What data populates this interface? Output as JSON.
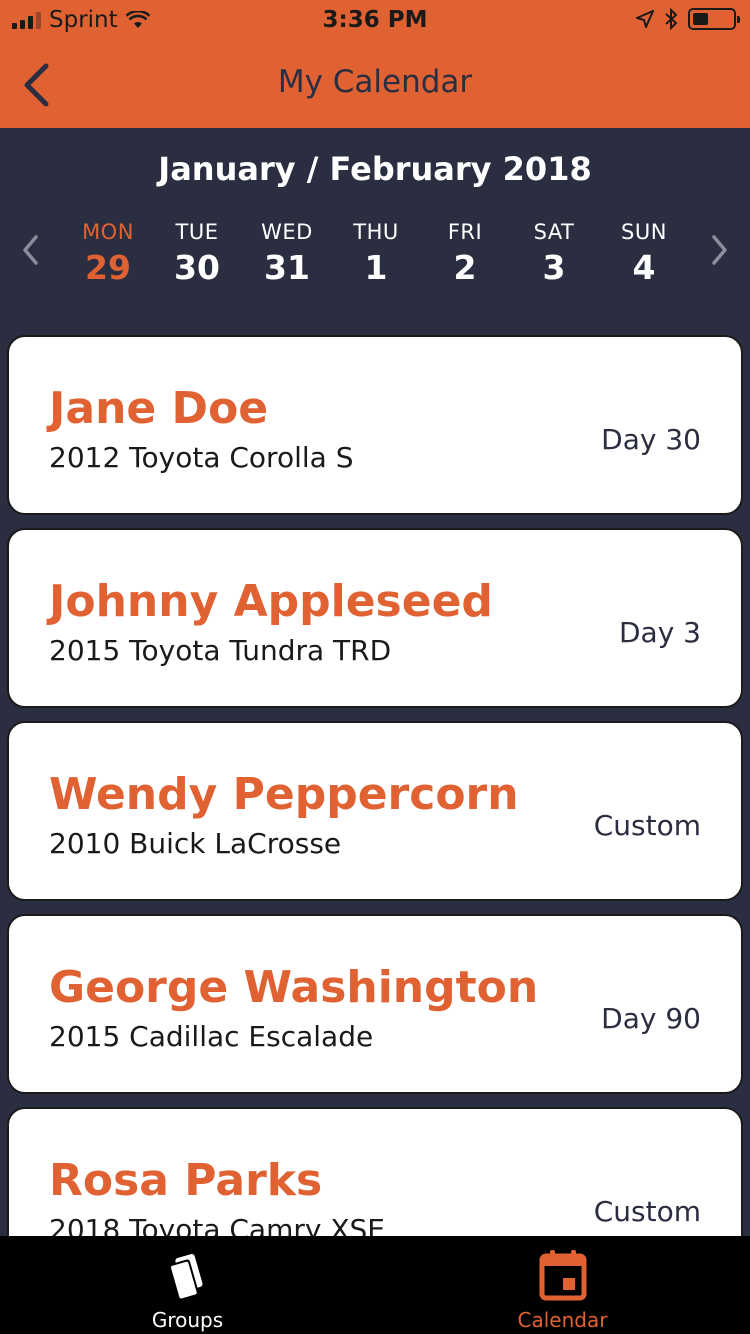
{
  "status_bar": {
    "carrier": "Sprint",
    "time": "3:36 PM"
  },
  "nav": {
    "title": "My Calendar",
    "back_icon": "chevron-left-icon"
  },
  "calendar": {
    "month_label": "January / February 2018",
    "days": [
      {
        "weekday": "MON",
        "date": "29",
        "active": true
      },
      {
        "weekday": "TUE",
        "date": "30",
        "active": false
      },
      {
        "weekday": "WED",
        "date": "31",
        "active": false
      },
      {
        "weekday": "THU",
        "date": "1",
        "active": false
      },
      {
        "weekday": "FRI",
        "date": "2",
        "active": false
      },
      {
        "weekday": "SAT",
        "date": "3",
        "active": false
      },
      {
        "weekday": "SUN",
        "date": "4",
        "active": false
      }
    ]
  },
  "appointments": [
    {
      "name": "Jane Doe",
      "vehicle": "2012 Toyota Corolla S",
      "tag": "Day 30"
    },
    {
      "name": "Johnny Appleseed",
      "vehicle": "2015 Toyota Tundra TRD",
      "tag": "Day 3"
    },
    {
      "name": "Wendy Peppercorn",
      "vehicle": "2010 Buick LaCrosse",
      "tag": "Custom"
    },
    {
      "name": "George Washington",
      "vehicle": "2015 Cadillac Escalade",
      "tag": "Day 90"
    },
    {
      "name": "Rosa Parks",
      "vehicle": "2018 Toyota Camry XSE",
      "tag": "Custom"
    }
  ],
  "tabs": [
    {
      "label": "Groups",
      "icon": "cards-icon",
      "active": false
    },
    {
      "label": "Calendar",
      "icon": "calendar-icon",
      "active": true
    }
  ],
  "colors": {
    "accent": "#e06233",
    "background": "#2b2e40",
    "card": "#ffffff",
    "tabbar": "#000000"
  }
}
